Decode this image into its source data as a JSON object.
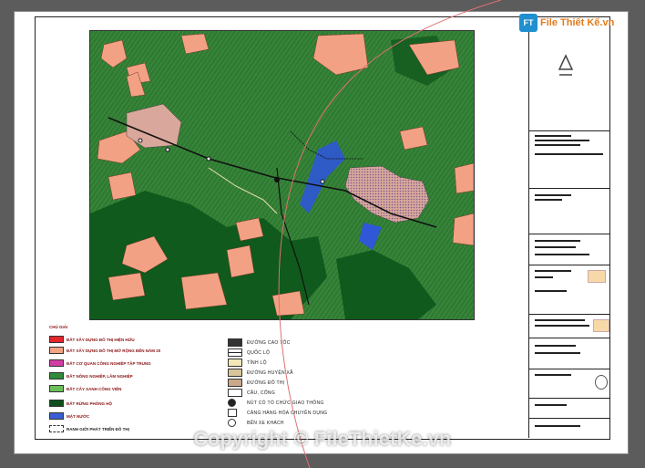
{
  "logo": {
    "text": "File Thiết Kế.vn",
    "mark": "FT"
  },
  "watermark": "Copyright © FileThietKe.vn",
  "legend_left_title": "CHÚ GIẢI",
  "legend_left": [
    {
      "label": "ĐẤT XÂY DỰNG ĐÔ THỊ HIỆN HỮU",
      "color": "#e3262b"
    },
    {
      "label": "ĐẤT XÂY DỰNG ĐÔ THỊ MỞ RỘNG ĐẾN NĂM 20",
      "color": "#f2a585"
    },
    {
      "label": "ĐẤT CƠ QUAN CÔNG NGHIỆP TẬP TRUNG",
      "color": "#d23ca5"
    },
    {
      "label": "ĐẤT NÔNG NGHIỆP, LÂM NGHIỆP",
      "color": "#2f8a3a"
    },
    {
      "label": "ĐẤT CÂY XANH CÔNG VIÊN",
      "color": "#6bbf5a"
    },
    {
      "label": "ĐẤT RỪNG PHÒNG HỘ",
      "color": "#0e4f1c"
    },
    {
      "label": "MẶT NƯỚC",
      "color": "#3a5fd1"
    },
    {
      "label": "RANH GIỚI PHÁT TRIỂN ĐÔ THỊ",
      "color": "#ffffff"
    }
  ],
  "legend_right": [
    {
      "label": "ĐƯỜNG CAO TỐC"
    },
    {
      "label": "QUỐC LỘ"
    },
    {
      "label": "TỈNH LỘ"
    },
    {
      "label": "ĐƯỜNG HUYỆN XÃ"
    },
    {
      "label": "ĐƯỜNG ĐÔ THỊ"
    },
    {
      "label": "CẦU, CỐNG"
    },
    {
      "label": "NÚT CÓ TỔ CHỨC GIAO THÔNG"
    },
    {
      "label": "CẢNG HÀNG HÓA CHUYÊN DỤNG"
    },
    {
      "label": "BẾN XE KHÁCH"
    }
  ],
  "colors": {
    "forest": "#0f5a1c",
    "agri": "#2e7d34",
    "urban": "#f3a184",
    "water": "#2f57d6"
  }
}
